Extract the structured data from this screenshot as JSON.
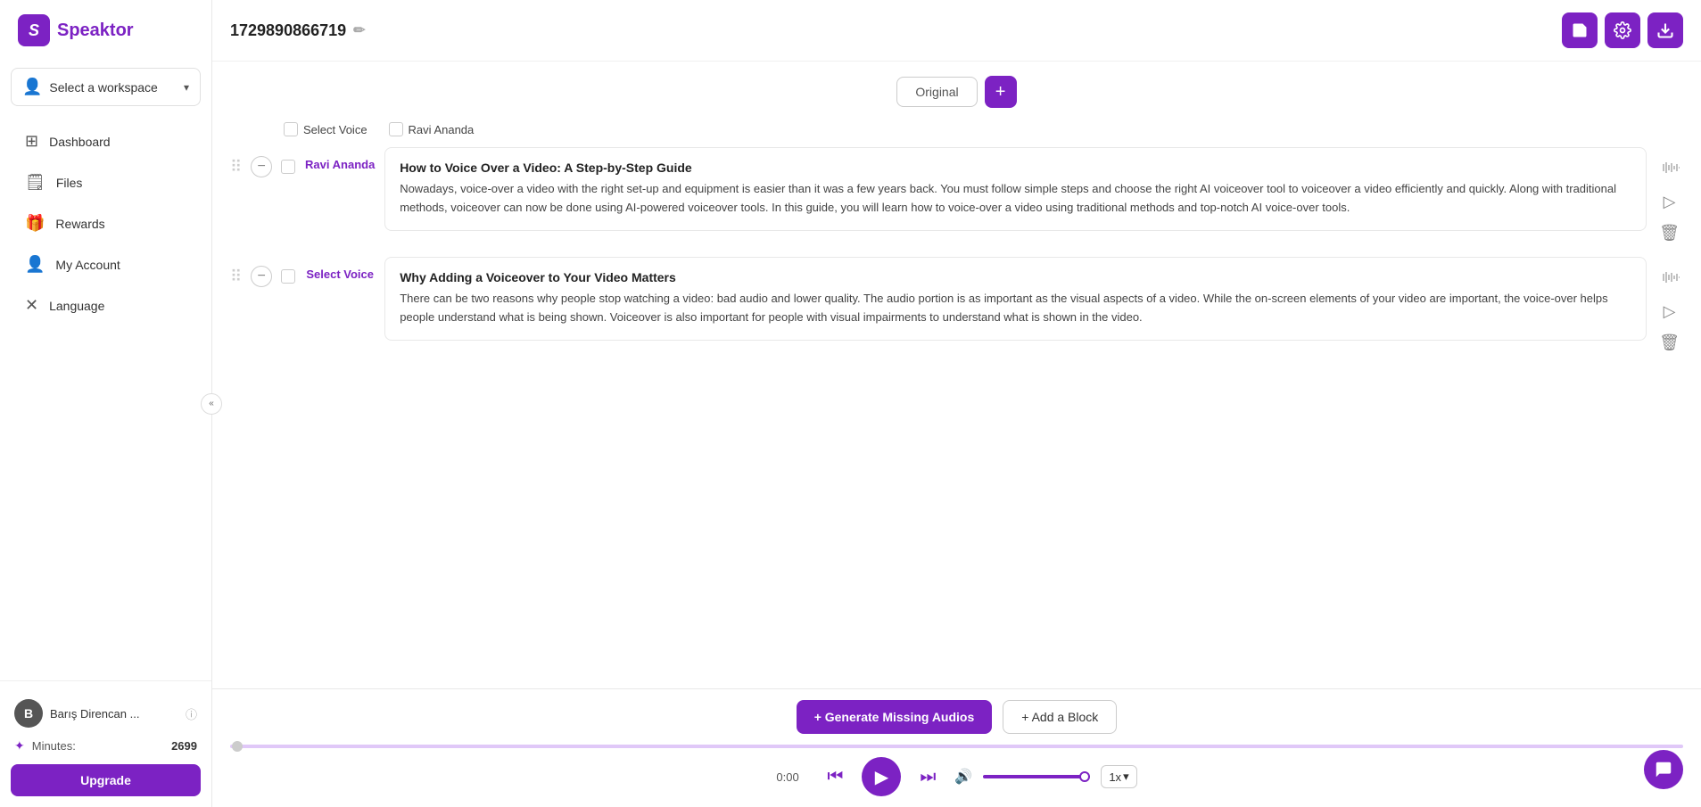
{
  "app": {
    "name": "Speaktor",
    "logo_letter": "S"
  },
  "sidebar": {
    "workspace": {
      "label": "Select a workspace",
      "chevron": "▾"
    },
    "nav_items": [
      {
        "id": "dashboard",
        "label": "Dashboard",
        "icon": "⊞"
      },
      {
        "id": "files",
        "label": "Files",
        "icon": "🗒"
      },
      {
        "id": "rewards",
        "label": "Rewards",
        "icon": "🎁"
      },
      {
        "id": "my-account",
        "label": "My Account",
        "icon": "👤"
      },
      {
        "id": "language",
        "label": "Language",
        "icon": "✕"
      }
    ],
    "user": {
      "avatar_letter": "B",
      "name": "Barış Direncan ...",
      "info_icon": "ⓘ"
    },
    "minutes": {
      "label": "Minutes:",
      "value": "2699"
    },
    "upgrade_label": "Upgrade"
  },
  "topbar": {
    "project_id": "1729890866719",
    "edit_icon": "✏",
    "actions": [
      {
        "id": "save",
        "icon": "⊞"
      },
      {
        "id": "settings",
        "icon": "✦"
      },
      {
        "id": "download",
        "icon": "↓"
      }
    ]
  },
  "version_tabs": [
    {
      "id": "original",
      "label": "Original",
      "active": true
    },
    {
      "id": "add",
      "label": "+"
    }
  ],
  "voice_selects": [
    {
      "id": "voice-1",
      "label": "Select Voice"
    },
    {
      "id": "voice-2",
      "label": "Ravi Ananda"
    }
  ],
  "blocks": [
    {
      "id": "block-1",
      "voice": "Ravi Ananda",
      "title": "How to Voice Over a Video: A Step-by-Step Guide",
      "body": "Nowadays, voice-over a video with the right set-up and equipment is easier than it was a few years back. You must follow simple steps and choose the right AI voiceover tool to voiceover a video efficiently and quickly. Along with traditional methods, voiceover can now be done using AI-powered voiceover tools. In this guide, you will learn how to voice-over a video using traditional methods and top-notch AI voice-over tools."
    },
    {
      "id": "block-2",
      "voice": "Select Voice",
      "title": "Why Adding a Voiceover to Your Video Matters",
      "body": "There can be two reasons why people stop watching a video: bad audio and lower quality. The audio portion is as important as the visual aspects of a video. While the on-screen elements of your video are important, the voice-over helps people understand what is being shown. Voiceover is also important for people with visual impairments to understand what is shown in the video."
    }
  ],
  "bottombar": {
    "generate_btn": "+ Generate Missing Audios",
    "add_block_btn": "+ Add a Block",
    "time": "0:00",
    "speed": "1x"
  },
  "chat_icon": "💬"
}
